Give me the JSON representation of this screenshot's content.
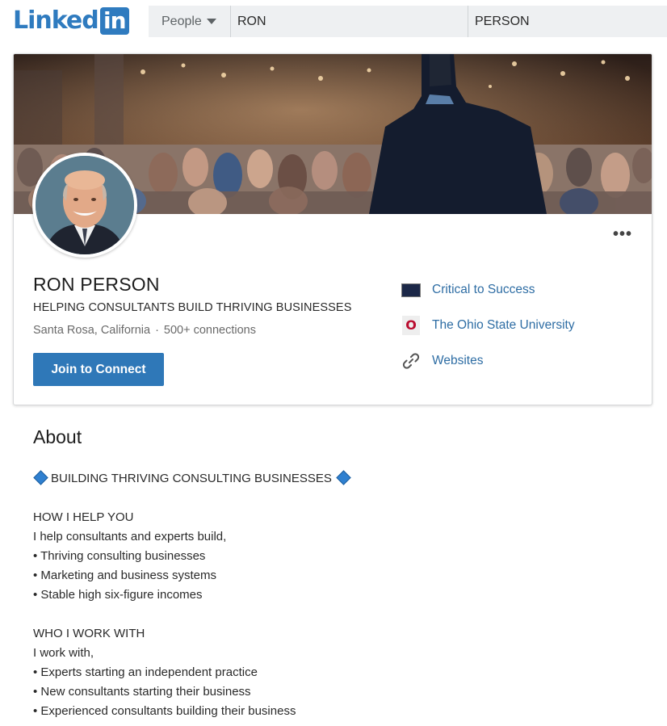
{
  "header": {
    "logo_text": "Linked",
    "logo_box": "in",
    "search": {
      "type_label": "People",
      "first_name": "RON",
      "last_name": "PERSON"
    }
  },
  "profile": {
    "name": "RON PERSON",
    "headline": "HELPING CONSULTANTS BUILD THRIVING BUSINESSES",
    "location": "Santa Rosa, California",
    "separator": "·",
    "connections": "500+ connections",
    "join_label": "Join to Connect",
    "more_label": "•••",
    "links": [
      {
        "label": "Critical to Success",
        "icon": "company-logo-icon"
      },
      {
        "label": "The Ohio State University",
        "icon": "university-logo-icon"
      },
      {
        "label": "Websites",
        "icon": "link-icon"
      }
    ],
    "osu_letter": "O"
  },
  "about": {
    "title": "About",
    "tagline": "BUILDING THRIVING CONSULTING BUSINESSES",
    "section1_title": "HOW I HELP YOU",
    "section1_intro": "I help consultants and experts build,",
    "section1_items": [
      "• Thriving consulting businesses",
      "• Marketing and business systems",
      "• Stable high six-figure incomes"
    ],
    "section2_title": "WHO I WORK WITH",
    "section2_intro": "I work with,",
    "section2_items": [
      "• Experts starting an independent practice",
      "• New consultants starting their business",
      "• Experienced consultants building their business"
    ]
  },
  "colors": {
    "brand": "#2f7bbf",
    "button": "#2f78b8",
    "link": "#2e6da4"
  }
}
